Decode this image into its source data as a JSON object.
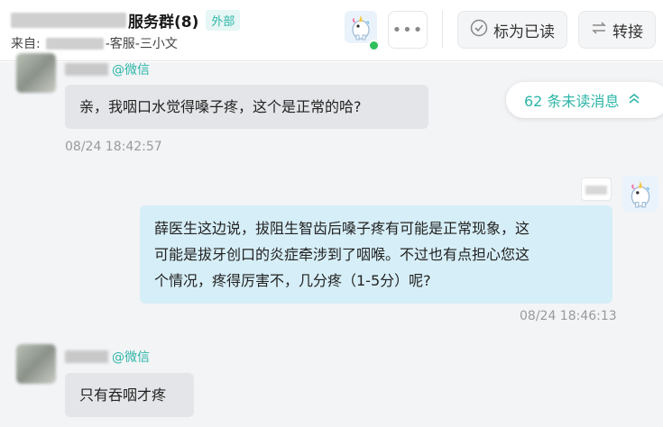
{
  "header": {
    "group_name_visible": "服务群(8)",
    "external_tag": "外部",
    "source_prefix": "来自:",
    "source_suffix": "-客服-三小文",
    "mark_read_label": "标为已读",
    "transfer_label": "转接",
    "more_glyph": "•••"
  },
  "unread": {
    "label": "62 条未读消息"
  },
  "messages": [
    {
      "source": "@微信",
      "text": "亲，我咽口水觉得嗓子疼，这个是正常的哈?",
      "time": "08/24 18:42:57"
    },
    {
      "text_lines": [
        "薛医生这边说，拔阻生智齿后嗓子疼有可能是正常现象，这",
        "可能是拔牙创口的炎症牵涉到了咽喉。不过也有点担心您这",
        "个情况，疼得厉害不，几分疼（1-5分）呢?"
      ],
      "time": "08/24 18:46:13"
    },
    {
      "source": "@微信",
      "text": "只有吞咽才疼"
    }
  ],
  "colors": {
    "accent": "#2eb6a8",
    "online": "#2fbf5b",
    "bubble_in": "#e4e5e8",
    "bubble_out": "#d6eef7"
  }
}
